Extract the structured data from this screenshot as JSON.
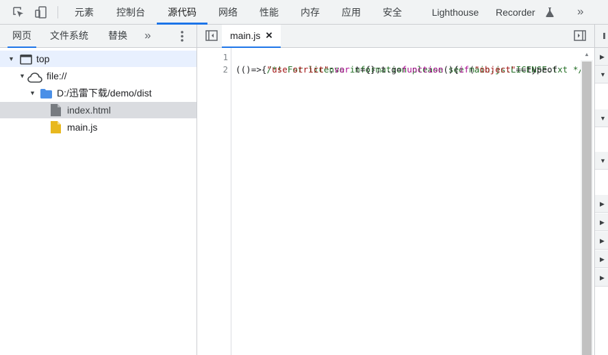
{
  "toolbar": {
    "inspect_icon": "inspect-element-icon",
    "device_icon": "device-toolbar-icon",
    "tabs": [
      {
        "label": "元素"
      },
      {
        "label": "控制台"
      },
      {
        "label": "源代码",
        "active": true
      },
      {
        "label": "网络"
      },
      {
        "label": "性能"
      },
      {
        "label": "内存"
      },
      {
        "label": "应用"
      },
      {
        "label": "安全"
      },
      {
        "label": "Lighthouse"
      },
      {
        "label": "Recorder"
      }
    ],
    "recorder_icon": "flask-icon",
    "more_label": "»"
  },
  "navigator": {
    "tabs": [
      {
        "label": "网页",
        "active": true
      },
      {
        "label": "文件系统"
      },
      {
        "label": "替换"
      }
    ],
    "more_label": "»",
    "menu_icon": "vertical-dots-icon",
    "tree": [
      {
        "label": "top",
        "icon": "frame-icon",
        "expanded": true
      },
      {
        "label": "file://",
        "icon": "cloud-icon",
        "expanded": true
      },
      {
        "label": "D:/迅雷下载/demo/dist",
        "icon": "folder-icon",
        "expanded": true
      },
      {
        "label": "index.html",
        "icon": "file-icon"
      },
      {
        "label": "main.js",
        "icon": "js-file-icon"
      }
    ]
  },
  "editor": {
    "toggle_navigator_icon": "sidebar-toggle-icon",
    "open_file": {
      "label": "main.js",
      "close": "×"
    },
    "toggle_debugger_icon": "debugger-toggle-icon",
    "line_numbers": [
      "1",
      "2"
    ],
    "lines": {
      "l1": "/*! For license information please see main.js.LICENSE.txt */",
      "l2_a": "(()=>{",
      "l2_b": "\"use strict\"",
      "l2_c": ";",
      "l2_d": "var",
      "l2_e": " t={};t.g=",
      "l2_f": "function",
      "l2_g": "(){",
      "l2_h": "if",
      "l2_i": "(",
      "l2_j": "\"object\"",
      "l2_k": "==typeof"
    }
  },
  "colors": {
    "accent": "#1a73e8",
    "comment": "#236e25",
    "string": "#a31515",
    "keyword": "#aa0d91",
    "folder": "#4a8fe7",
    "js_file": "#e8b81f"
  }
}
